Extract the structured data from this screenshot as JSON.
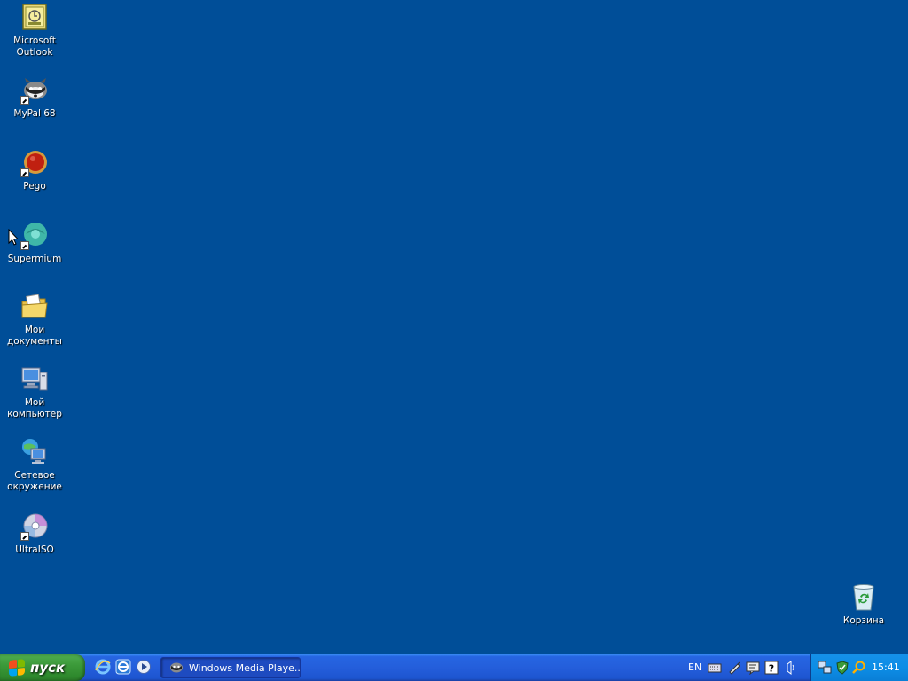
{
  "desktop": {
    "icons": [
      {
        "label": "Microsoft Outlook",
        "icon": "outlook-icon"
      },
      {
        "label": "MyPal 68",
        "icon": "mypal-icon"
      },
      {
        "label": "Pego",
        "icon": "pego-icon"
      },
      {
        "label": "Supermium",
        "icon": "supermium-icon"
      },
      {
        "label": "Мои документы",
        "icon": "my-documents-icon"
      },
      {
        "label": "Мой компьютер",
        "icon": "my-computer-icon"
      },
      {
        "label": "Сетевое окружение",
        "icon": "network-places-icon"
      },
      {
        "label": "UltraISO",
        "icon": "ultraiso-icon"
      },
      {
        "label": "Корзина",
        "icon": "recycle-bin-icon"
      }
    ]
  },
  "taskbar": {
    "start_label": "пуск",
    "quick_launch": [
      "internet-explorer-icon",
      "ie-alt-icon",
      "media-player-icon"
    ],
    "tasks": [
      {
        "label": "Windows Media Playe...",
        "icon": "mypal-icon"
      }
    ],
    "language": "EN",
    "tray_icons": [
      "keyboard-icon",
      "pen-icon",
      "monitor-chat-icon",
      "help-icon",
      "volume-icon",
      "network-icon",
      "shield-icon",
      "search-icon"
    ],
    "clock": "15:41"
  },
  "colors": {
    "desktop_bg": "#004e98",
    "taskbar_blue": "#245edb",
    "start_green": "#3c9a3a",
    "tray_blue": "#0d8de6"
  }
}
